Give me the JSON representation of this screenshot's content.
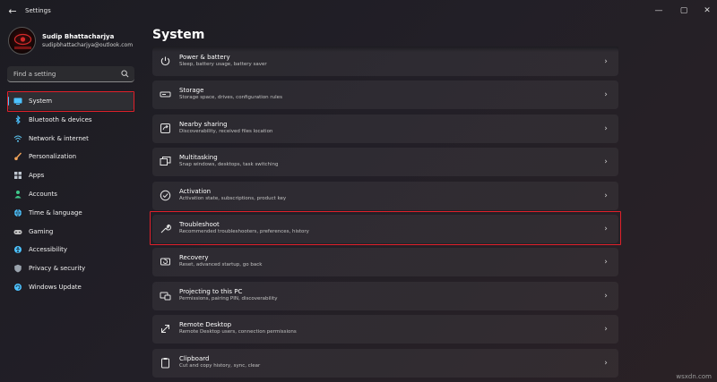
{
  "window": {
    "title": "Settings",
    "back_glyph": "←",
    "minimize_glyph": "—",
    "maximize_glyph": "▢",
    "close_glyph": "✕"
  },
  "profile": {
    "name": "Sudip Bhattacharjya",
    "email": "sudipbhattacharjya@outlook.com"
  },
  "search": {
    "placeholder": "Find a setting",
    "icon": "search-icon"
  },
  "sidebar": {
    "items": [
      {
        "label": "System",
        "icon": "system-icon",
        "color": "#4cc2ff",
        "selected": true
      },
      {
        "label": "Bluetooth & devices",
        "icon": "bluetooth-icon",
        "color": "#4cc2ff"
      },
      {
        "label": "Network & internet",
        "icon": "wifi-icon",
        "color": "#5ec8f5"
      },
      {
        "label": "Personalization",
        "icon": "brush-icon",
        "color": "#f2a45a"
      },
      {
        "label": "Apps",
        "icon": "apps-icon",
        "color": "#bfc6d0"
      },
      {
        "label": "Accounts",
        "icon": "person-icon",
        "color": "#3fc88a"
      },
      {
        "label": "Time & language",
        "icon": "globe-icon",
        "color": "#4cc2ff"
      },
      {
        "label": "Gaming",
        "icon": "gamepad-icon",
        "color": "#c3c3c3"
      },
      {
        "label": "Accessibility",
        "icon": "accessibility-icon",
        "color": "#4cc2ff"
      },
      {
        "label": "Privacy & security",
        "icon": "shield-icon",
        "color": "#9aa3ad"
      },
      {
        "label": "Windows Update",
        "icon": "update-icon",
        "color": "#4cc2ff"
      }
    ]
  },
  "main": {
    "title": "System",
    "cards": [
      {
        "title": "Power & battery",
        "subtitle": "Sleep, battery usage, battery saver",
        "icon": "power-icon"
      },
      {
        "title": "Storage",
        "subtitle": "Storage space, drives, configuration rules",
        "icon": "storage-icon"
      },
      {
        "title": "Nearby sharing",
        "subtitle": "Discoverability, received files location",
        "icon": "share-icon"
      },
      {
        "title": "Multitasking",
        "subtitle": "Snap windows, desktops, task switching",
        "icon": "multitasking-icon"
      },
      {
        "title": "Activation",
        "subtitle": "Activation state, subscriptions, product key",
        "icon": "check-circle-icon"
      },
      {
        "title": "Troubleshoot",
        "subtitle": "Recommended troubleshooters, preferences, history",
        "icon": "wrench-icon"
      },
      {
        "title": "Recovery",
        "subtitle": "Reset, advanced startup, go back",
        "icon": "recovery-icon"
      },
      {
        "title": "Projecting to this PC",
        "subtitle": "Permissions, pairing PIN, discoverability",
        "icon": "projecting-icon"
      },
      {
        "title": "Remote Desktop",
        "subtitle": "Remote Desktop users, connection permissions",
        "icon": "remote-desktop-icon"
      },
      {
        "title": "Clipboard",
        "subtitle": "Cut and copy history, sync, clear",
        "icon": "clipboard-icon"
      }
    ],
    "chevron": "›"
  },
  "colors": {
    "accent": "#4cc2ff",
    "highlight_border": "#e0202a"
  },
  "watermark": "wsxdn.com"
}
